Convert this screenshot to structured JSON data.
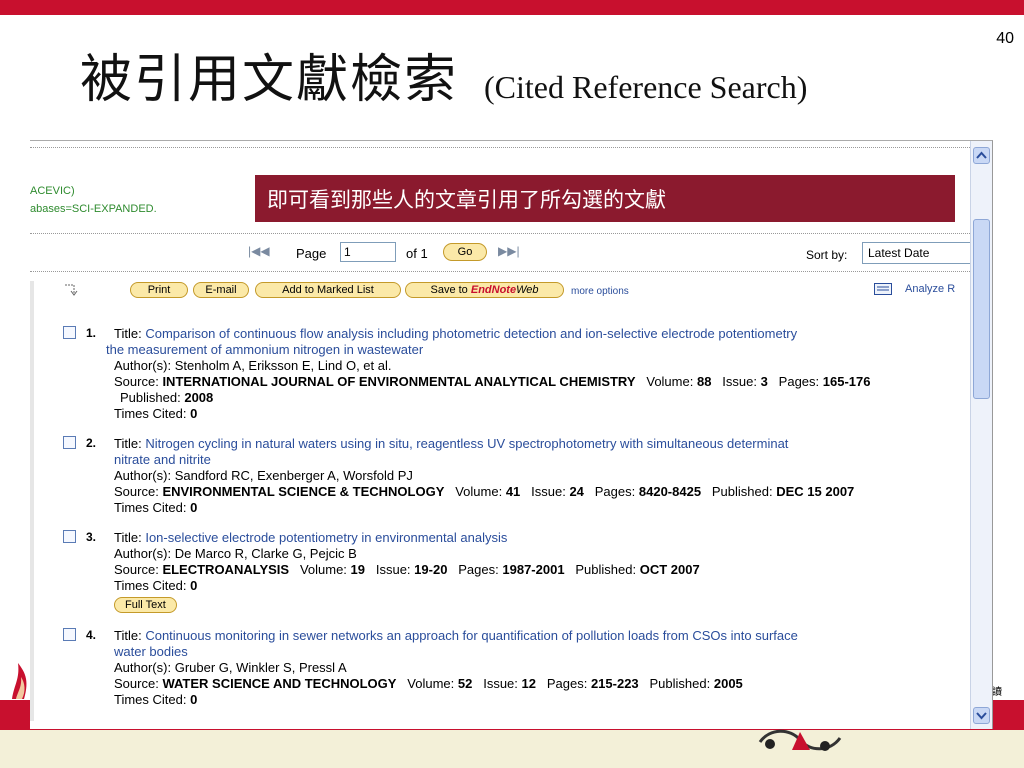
{
  "slide": {
    "number": "40",
    "title_zh": "被引用文獻檢索",
    "title_en": "(Cited Reference Search)",
    "right_label": "讀"
  },
  "screenshot": {
    "context_line1": "ACEVIC)",
    "context_line2": "abases=SCI-EXPANDED.",
    "callout": "即可看到那些人的文章引用了所勾選的文獻",
    "pager": {
      "page_label": "Page",
      "page_value": "1",
      "of_label": "of 1",
      "go_label": "Go",
      "sort_label": "Sort by:",
      "sort_value": "Latest Date"
    },
    "toolbar": {
      "print": "Print",
      "email": "E-mail",
      "add_marked": "Add to Marked List",
      "save_to": "Save to",
      "endnote": "EndNote",
      "web": "Web",
      "more_options": "more options",
      "analyze": "Analyze R"
    },
    "labels": {
      "title": "Title:",
      "authors": "Author(s):",
      "source": "Source:",
      "volume": "Volume:",
      "issue": "Issue:",
      "pages": "Pages:",
      "published": "Published:",
      "times_cited": "Times Cited:",
      "full_text": "Full Text"
    },
    "records": [
      {
        "num": "1.",
        "title_l1": "Comparison of continuous flow analysis including photometric detection and ion-selective electrode potentiometry",
        "title_l2": "the measurement of ammonium nitrogen in wastewater",
        "authors": "Stenholm A, Eriksson E, Lind O, et al.",
        "source": "INTERNATIONAL JOURNAL OF ENVIRONMENTAL ANALYTICAL CHEMISTRY",
        "volume": "88",
        "issue": "3",
        "pages": "165-176",
        "published": "2008",
        "times_cited": "0"
      },
      {
        "num": "2.",
        "title_l1": "Nitrogen cycling in natural waters using in situ, reagentless UV spectrophotometry with simultaneous determinat",
        "title_l2": "nitrate and nitrite",
        "authors": "Sandford RC, Exenberger A, Worsfold PJ",
        "source": "ENVIRONMENTAL SCIENCE & TECHNOLOGY",
        "volume": "41",
        "issue": "24",
        "pages": "8420-8425",
        "published": "DEC 15 2007",
        "times_cited": "0"
      },
      {
        "num": "3.",
        "title_l1": "Ion-selective electrode potentiometry in environmental analysis",
        "authors": "De Marco R, Clarke G, Pejcic B",
        "source": "ELECTROANALYSIS",
        "volume": "19",
        "issue": "19-20",
        "pages": "1987-2001",
        "published": "OCT 2007",
        "times_cited": "0"
      },
      {
        "num": "4.",
        "title_l1": "Continuous monitoring in sewer networks an approach for quantification of pollution loads from CSOs into surface",
        "title_l2": "water bodies",
        "authors": "Gruber G, Winkler S, Pressl A",
        "source": "WATER SCIENCE AND TECHNOLOGY",
        "volume": "52",
        "issue": "12",
        "pages": "215-223",
        "published": "2005",
        "times_cited": "0"
      }
    ]
  },
  "colors": {
    "brand_red": "#c8102e",
    "callout_bg": "#8b1a2e",
    "link_blue": "#2a4d9b",
    "button_fill": "#fbe9a8"
  }
}
